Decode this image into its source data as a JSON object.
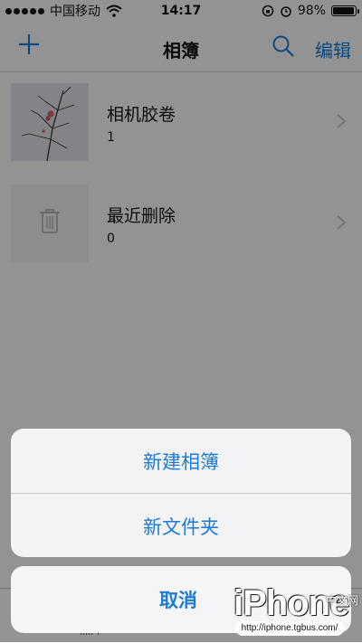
{
  "status_bar": {
    "carrier": "中国移动",
    "time": "14:17",
    "battery": "98%",
    "battery_level": 0.98,
    "signal_dots": 5
  },
  "nav": {
    "title": "相簿",
    "edit_label": "编辑"
  },
  "albums": [
    {
      "name": "相机胶卷",
      "count": "1"
    },
    {
      "name": "最近删除",
      "count": "0"
    }
  ],
  "tab_bar": {
    "tabs": [
      {
        "label": "照片"
      },
      {
        "label": "相簿"
      }
    ]
  },
  "action_sheet": {
    "new_album": "新建相簿",
    "new_folder": "新文件夹",
    "cancel": "取消"
  },
  "watermark": {
    "brand": "iPhone",
    "chinese": "中文网",
    "url": "http://iphone.tgbus.com/"
  },
  "colors": {
    "accent": "#1b7bd5",
    "dim_overlay": "rgba(0,0,0,0.40)"
  }
}
